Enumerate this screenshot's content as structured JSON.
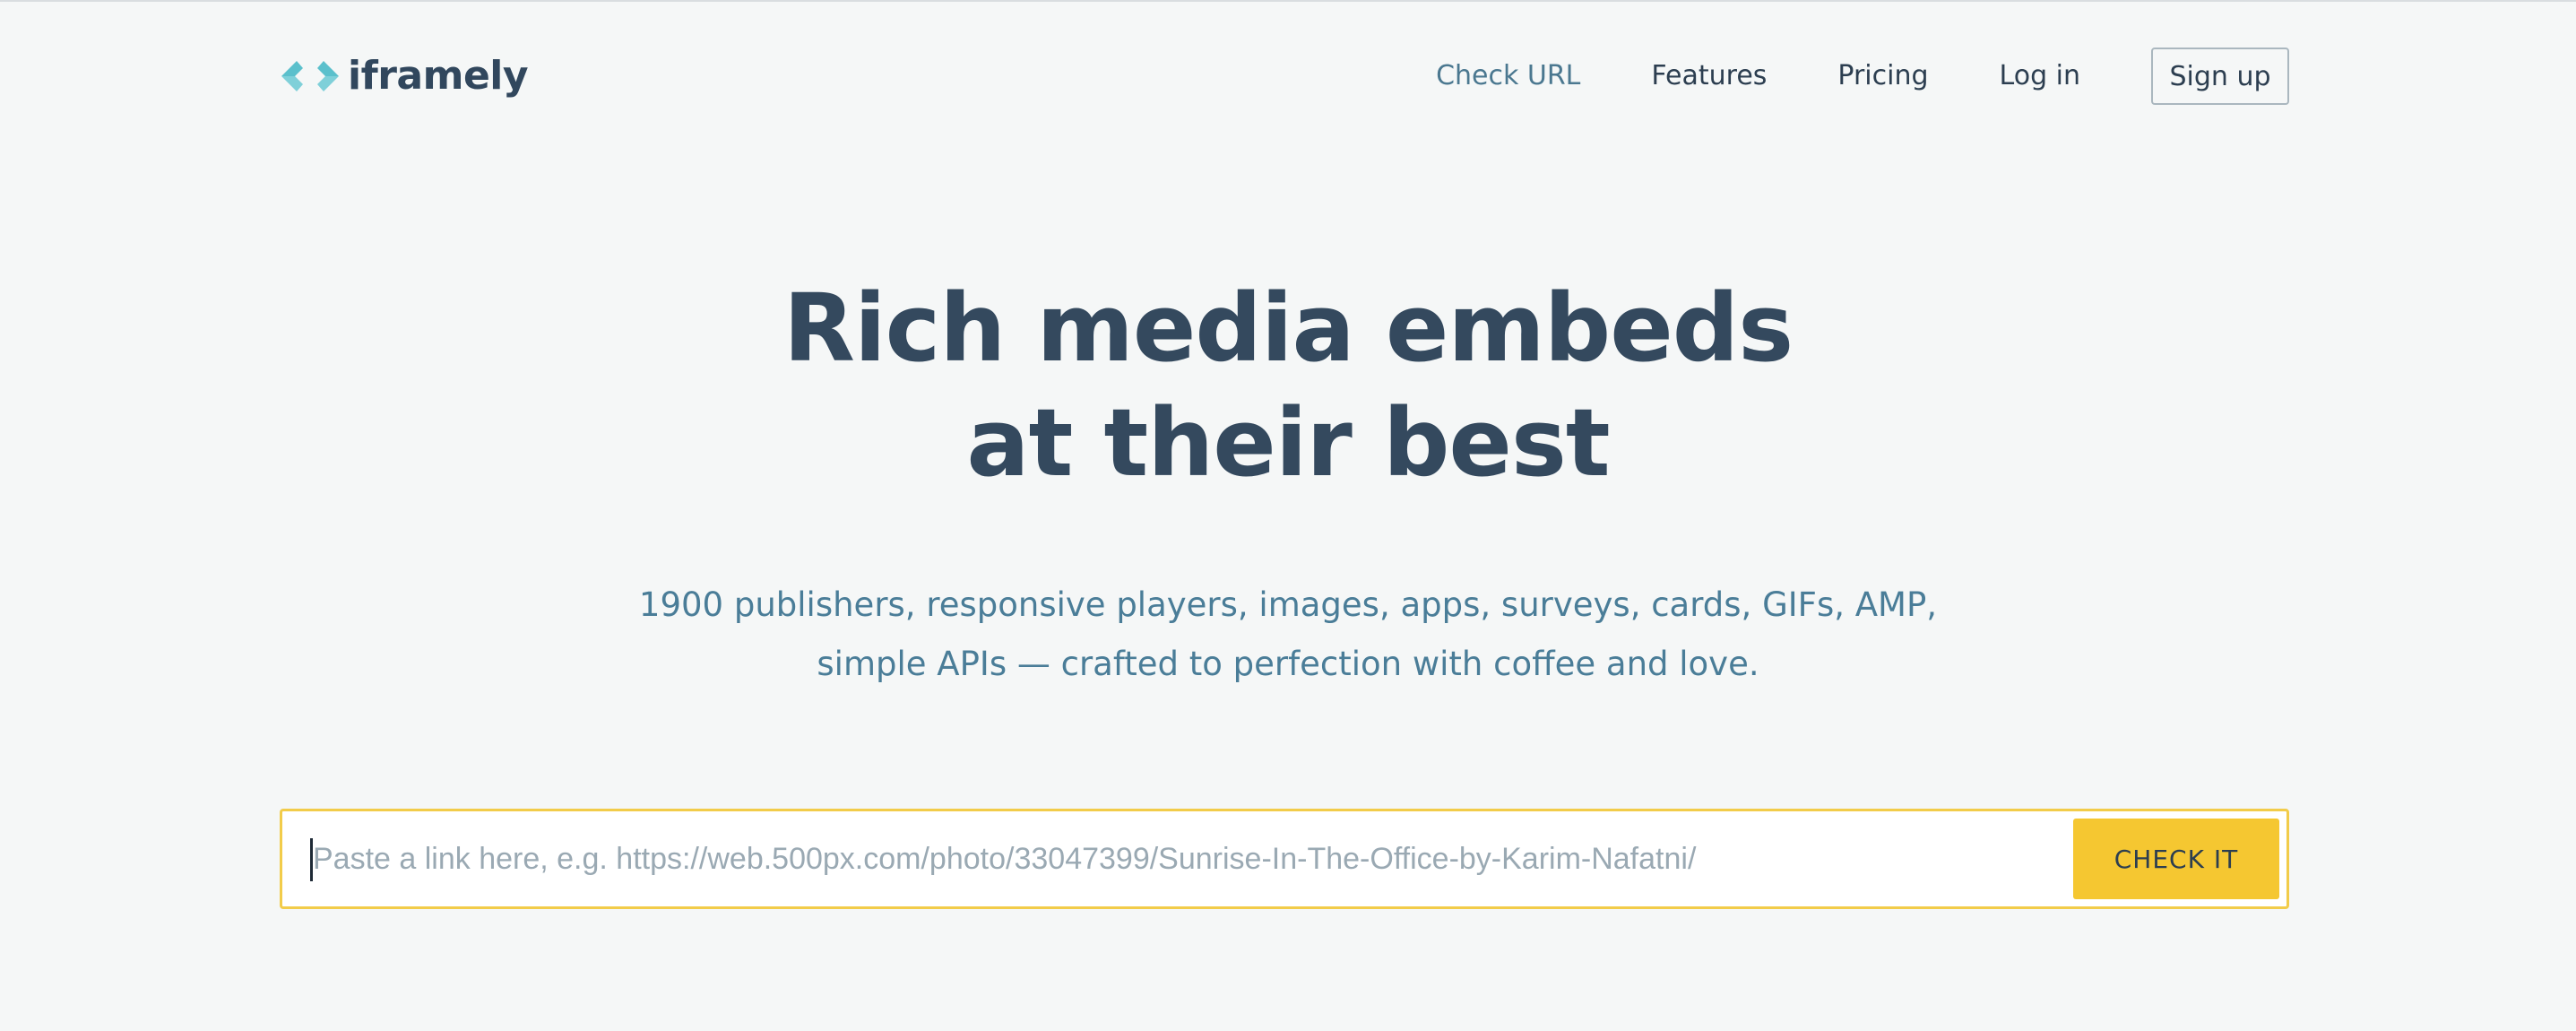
{
  "header": {
    "logo_text": "iframely",
    "logo_icon": "iframely-logo-icon",
    "nav": [
      {
        "label": "Check URL",
        "active": true
      },
      {
        "label": "Features",
        "active": false
      },
      {
        "label": "Pricing",
        "active": false
      },
      {
        "label": "Log in",
        "active": false
      }
    ],
    "signup_label": "Sign up"
  },
  "hero": {
    "title_line1": "Rich media embeds",
    "title_line2": "at their best",
    "subtitle_line1": "1900 publishers, responsive players, images, apps, surveys, cards, GIFs, AMP,",
    "subtitle_line2": "simple APIs — crafted to perfection with coffee and love."
  },
  "search": {
    "placeholder": "Paste a link here, e.g. https://web.500px.com/photo/33047399/Sunrise-In-The-Office-by-Karim-Nafatni/",
    "value": "",
    "button_label": "CHECK IT"
  },
  "colors": {
    "accent": "#f5c731",
    "logo_teal": "#5bc0cc",
    "text_dark": "#34495e",
    "text_muted_blue": "#4a7d98",
    "background": "#f5f7f7"
  }
}
